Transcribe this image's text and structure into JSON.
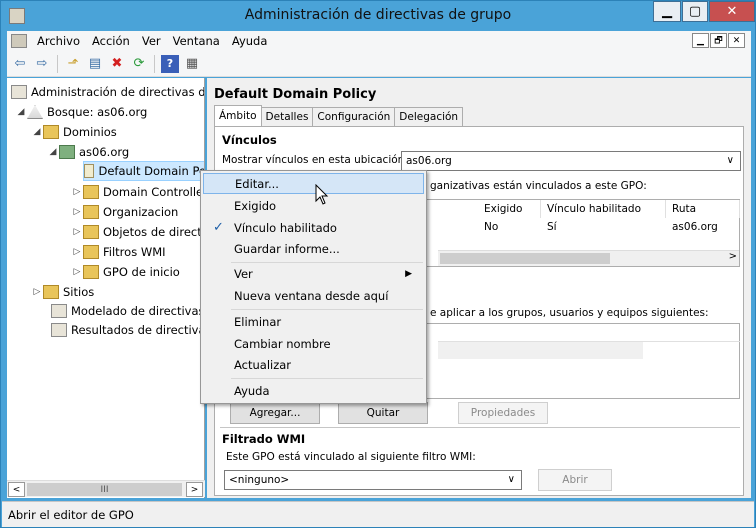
{
  "window": {
    "title": "Administración de directivas de grupo",
    "min_icon": "minimize-icon",
    "max_icon": "maximize-icon",
    "close_icon": "close-icon",
    "close_color": "#c75050",
    "frame_color": "#4aa3d8",
    "min_glyph": "▁",
    "max_glyph": "▢",
    "close_glyph": "✕"
  },
  "menubar": {
    "items": [
      "Archivo",
      "Acción",
      "Ver",
      "Ventana",
      "Ayuda"
    ],
    "mdi_buttons": [
      "▁",
      "🗗",
      "✕"
    ]
  },
  "toolbar": {
    "icons": [
      "back-arrow-icon",
      "forward-arrow-icon",
      "up-folder-icon",
      "show-hide-tree-icon",
      "delete-icon",
      "refresh-icon",
      "help-icon",
      "properties-icon"
    ],
    "glyphs": [
      "⇦",
      "⇨",
      "⬏",
      "▤",
      "✖",
      "⟳",
      "?",
      "▦"
    ]
  },
  "tree": {
    "items": [
      {
        "label": "Administración de directivas de g",
        "icon": "console-icon",
        "expander": ""
      },
      {
        "label": "Bosque: as06.org",
        "icon": "forest-icon",
        "expander": "◢"
      },
      {
        "label": "Dominios",
        "icon": "folder-icon",
        "expander": "◢"
      },
      {
        "label": "as06.org",
        "icon": "domain-icon",
        "expander": "◢"
      },
      {
        "label": "Default Domain Po",
        "icon": "gpo-link-icon",
        "expander": "",
        "selected": true
      },
      {
        "label": "Domain Controlle",
        "icon": "ou-folder-icon",
        "expander": "▷"
      },
      {
        "label": "Organizacion",
        "icon": "ou-folder-icon",
        "expander": "▷"
      },
      {
        "label": "Objetos de directi",
        "icon": "gpo-folder-icon",
        "expander": "▷"
      },
      {
        "label": "Filtros WMI",
        "icon": "wmi-folder-icon",
        "expander": "▷"
      },
      {
        "label": "GPO de inicio",
        "icon": "starter-gpo-icon",
        "expander": "▷"
      },
      {
        "label": "Sitios",
        "icon": "sites-icon",
        "expander": "▷"
      },
      {
        "label": "Modelado de directivas d",
        "icon": "modeling-icon",
        "expander": ""
      },
      {
        "label": "Resultados de directivas",
        "icon": "results-icon",
        "expander": ""
      }
    ],
    "scroll_left": "<",
    "scroll_right": ">",
    "scroll_grip": "III"
  },
  "details": {
    "title": "Default Domain Policy",
    "tabs": [
      "Ámbito",
      "Detalles",
      "Configuración",
      "Delegación"
    ],
    "links_section": "Vínculos",
    "links_location_label": "Mostrar vínculos en esta ubicación:",
    "links_location_value": "as06.org",
    "links_desc_fragment": "ganizativas están vinculados a este GPO:",
    "links_columns": [
      "Exigido",
      "Vínculo habilitado",
      "Ruta"
    ],
    "links_row": {
      "exigido": "No",
      "habilitado": "Sí",
      "ruta": "as06.org"
    },
    "filter_desc_fragment": "e aplicar a los grupos, usuarios y equipos siguientes:",
    "btn_add_fragment": "Agregar...",
    "btn_remove_fragment": "Quitar",
    "btn_properties": "Propiedades",
    "wmi_section": "Filtrado WMI",
    "wmi_label": "Este GPO está vinculado al siguiente filtro WMI:",
    "wmi_value": "<ninguno>",
    "wmi_open": "Abrir"
  },
  "context_menu": {
    "items": [
      {
        "label": "Editar...",
        "highlighted": true
      },
      {
        "label": "Exigido"
      },
      {
        "label": "Vínculo habilitado",
        "checked": true
      },
      {
        "label": "Guardar informe..."
      },
      {
        "label": "Ver",
        "submenu": true
      },
      {
        "label": "Nueva ventana desde aquí"
      },
      {
        "label": "Eliminar"
      },
      {
        "label": "Cambiar nombre"
      },
      {
        "label": "Actualizar"
      },
      {
        "label": "Ayuda"
      }
    ],
    "check_glyph": "✓",
    "submenu_glyph": "▶"
  },
  "status": {
    "text": "Abrir el editor de GPO"
  }
}
